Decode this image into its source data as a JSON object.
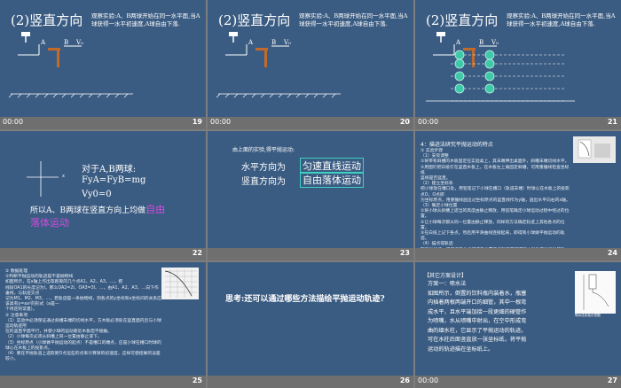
{
  "slides": [
    {
      "num": "19",
      "time": "00:00",
      "title": "(2)竖直方向",
      "note": "观察实验:A、B两球开始在同一水平面,当A球获得一水平初速度,A球自由下落.",
      "label_a": "A",
      "label_b": "B",
      "label_v0": "V₀"
    },
    {
      "num": "20",
      "time": "00:00",
      "title": "(2)竖直方向",
      "note": "观察实验:A、B两球开始在同一水平面,当A球获得一水平初速度,A球自由下落.",
      "label_a": "A",
      "label_b": "B",
      "label_v0": "V₀"
    },
    {
      "num": "21",
      "time": "00:00",
      "title": "(2)竖直方向",
      "note": "观察实验:A、B两球开始在同一水平面,当A球获得一水平初速度,A球自由下落.",
      "label_a": "A",
      "label_b": "B",
      "label_v0": "V₀"
    },
    {
      "num": "22",
      "time": "",
      "axis_x": "x",
      "line1": "对于A,B两球:",
      "line2": "FyA=FyB=mg",
      "line3": "Vy0=0",
      "line4": "所以A、B两球在竖直方向上均做",
      "hl": "自由落体运动"
    },
    {
      "num": "23",
      "time": "",
      "heading": "由上面的实验,得平抛运动:",
      "row1_label": "水平方向为",
      "row1_value": "匀速直线运动",
      "row2_label": "竖直方向为",
      "row2_value": "自由落体运动"
    },
    {
      "num": "24",
      "time": "",
      "heading": "4：描迹法研究平抛运动的特点",
      "body": [
        "① 实验步骤",
        "（1）安装调整",
        "①将带有斜槽的木板固定在实验桌上，其末端伸出桌面外，斜槽末端切线水平。",
        "②用图钉把白纸钉在竖直木板上，在木板左上角固定斜槽，可用重锤线检查坐标纸",
        "竖线是否竖直。",
        "（2）建立坐标系",
        "把小球放在槽口处，用铅笔记下小球在槽口（轨道末端）时球心在木板上的投影点O，O点即",
        "为坐标原点，用重锤线画出过坐标原点的竖直线作为y轴，画出水平向右的x轴。",
        "（3）确定小球位置",
        "①将小球从斜槽上适当的高度由静止释放，用铅笔确定小球运动过程中经过的位置。",
        "②让小球每次都从同一位置由静止释放，同样的方法确定轨迹上其他各点的位置。",
        "③在白纸上记下各点，然后用平滑曲线连接起来，即得到小球做平抛运动的轨迹。",
        "（4）描点得轨迹",
        "取下坐标纸，用平滑的曲线把这些位置连接起来即可得到小球做平抛运动的轨迹。"
      ]
    },
    {
      "num": "25",
      "time": "",
      "body": [
        "② 数据处理",
        "①判断平抛运动的轨迹是不是抛物线",
        "如图所示，在x轴上作出等距离的几个点A1、A2、A3、…，把",
        "线段OA1的长度记为l，那么OA2=2l、OA3=3l、…，由A1、A2、A3、…向下作垂线，与轨迹交点",
        "记为M1、M2、M3、…，若轨迹是一条抛物线，则各点的y坐标和x坐标间的关系应该具有y=ax²的形式（a是一",
        "个待定的常量）。",
        "② 注意事项",
        "（1）实验中必须保证通过斜槽末端的切线水平，方木板必须处在竖直面内且与小球运动轨迹所",
        "在的竖直平面平行，并使小球的运动靠近木板但不接触。",
        "（2）小球每次必须从斜槽上同一位置由静止滚下。",
        "（3）坐标原点（小球做平抛运动的起点）不是槽口的端点，应是小球在槽口时球的球心在木板上的投影点。",
        "（4）要在平抛轨道上选取距O点远些的点来计算球的初速度，这样可使结果的误差较小。"
      ]
    },
    {
      "num": "26",
      "time": "",
      "question": "思考:还可以通过哪些方法描绘平抛运动轨迹?"
    },
    {
      "num": "27",
      "time": "00:00",
      "heading": "【其它方案设计】",
      "body": [
        "方案一：喷水法",
        "如图所示，倒置的饮料瓶内装着水，瓶塞",
        "内插着两根两端开口的细管，其中一根弯",
        "成水平，且水平端加接一段更细的硬管作",
        "为喷嘴，水从喷嘴中射出，在空中形成弯",
        "曲的细水柱，它显示了平抛运动的轨迹。",
        "可在水柱后面竖直放一张坐标纸，将平抛",
        "运动的轨迹描在坐标纸上。"
      ],
      "caption": "喷水法实验示意图"
    }
  ]
}
